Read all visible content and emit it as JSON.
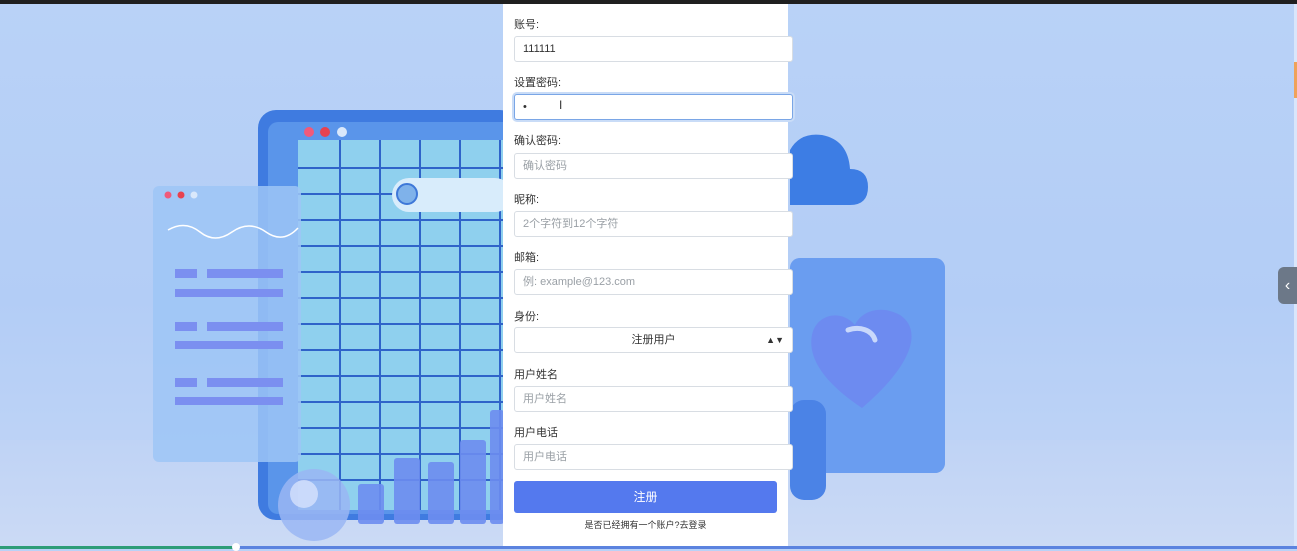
{
  "form": {
    "account_label": "账号:",
    "account_value": "111111",
    "password_label": "设置密码:",
    "password_value": "•",
    "confirm_label": "确认密码:",
    "confirm_placeholder": "确认密码",
    "nickname_label": "昵称:",
    "nickname_placeholder": "2个字符到12个字符",
    "email_label": "邮箱:",
    "email_placeholder": "例: example@123.com",
    "role_label": "身份:",
    "role_selected": "注册用户",
    "username_label": "用户姓名",
    "username_placeholder": "用户姓名",
    "phone_label": "用户电话",
    "phone_placeholder": "用户电话",
    "submit_label": "注册",
    "login_prompt": "是否已经拥有一个账户?去登录"
  },
  "side_toggle_icon": "chevron-left-icon",
  "colors": {
    "primary_button": "#5479ee",
    "background": "#b9d2f7",
    "focus_border": "#7aa6e6"
  }
}
